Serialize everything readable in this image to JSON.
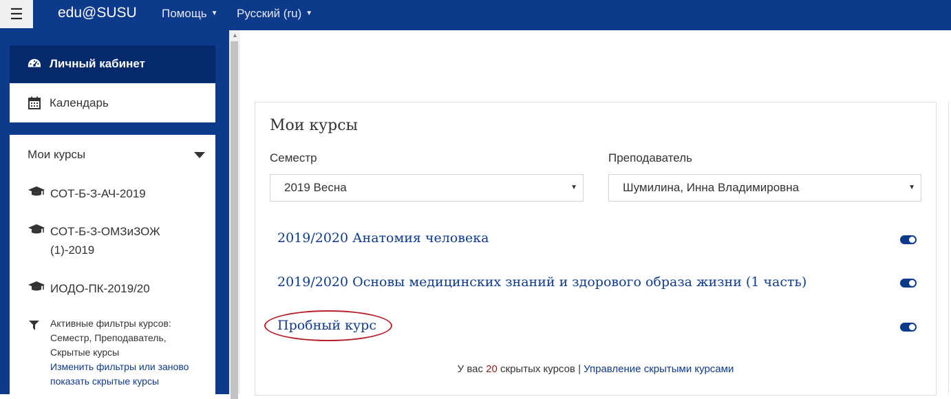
{
  "navbar": {
    "brand": "edu@SUSU",
    "help_menu": "Помощь",
    "language_menu": "Русский (ru)"
  },
  "drawer": {
    "dashboard_label": "Личный кабинет",
    "calendar_label": "Календарь",
    "my_courses_title": "Мои курсы",
    "courses": [
      {
        "label": "СОТ-Б-З-АЧ-2019"
      },
      {
        "label": "СОТ-Б-З-ОМЗиЗОЖ(1)-2019"
      },
      {
        "label": "ИОДО-ПК-2019/20"
      }
    ],
    "filter_text": "Активные фильтры курсов: Семестр, Преподаватель, Скрытые курсы",
    "filter_link": "Изменить фильтры или заново показать скрытые курсы"
  },
  "main": {
    "title": "Мои курсы",
    "semester_label": "Семестр",
    "semester_value": "2019 Весна",
    "teacher_label": "Преподаватель",
    "teacher_value": "Шумилина, Инна Владимировна",
    "courses": [
      {
        "name": "2019/2020 Анатомия человека"
      },
      {
        "name": "2019/2020 Основы медицинских знаний и здорового образа жизни (1 часть)"
      },
      {
        "name": "Пробный курс"
      }
    ],
    "footer_prefix": "У вас",
    "hidden_count": "20",
    "footer_suffix": "скрытых курсов |",
    "manage_link": "Управление скрытыми курсами"
  },
  "colors": {
    "brand": "#0e3a8c",
    "active_nav": "#042a6b",
    "annotation": "#b5202a"
  }
}
